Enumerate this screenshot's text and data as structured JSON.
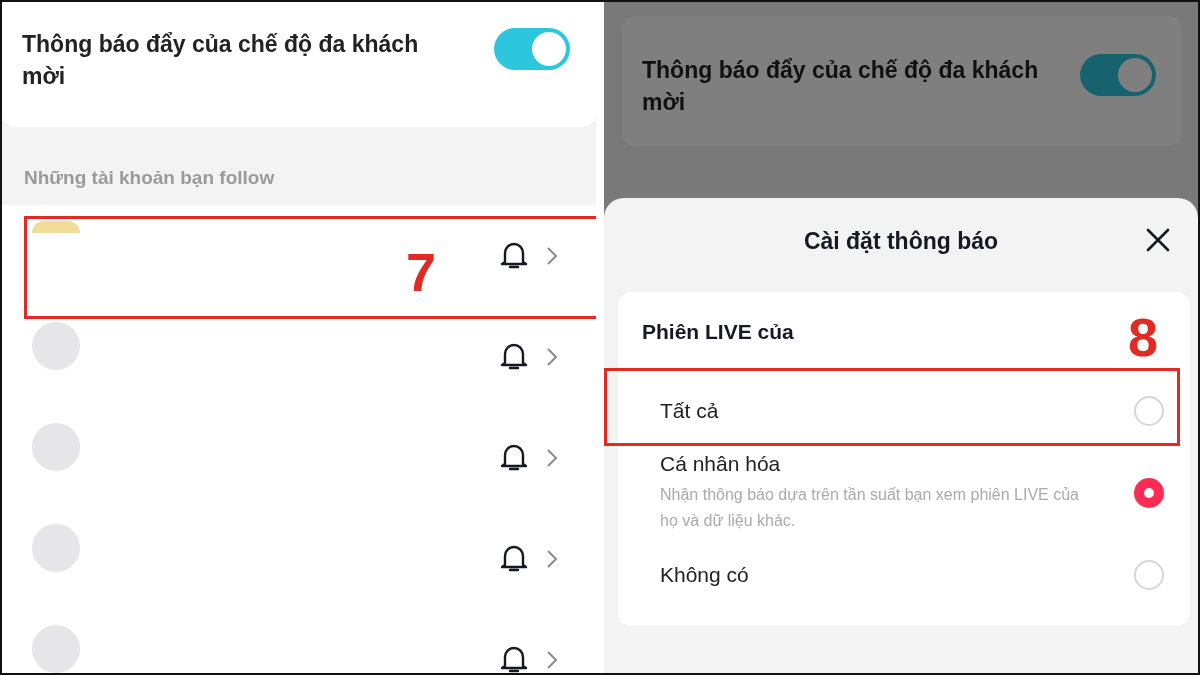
{
  "left": {
    "settings_card": {
      "label": "Thông báo đẩy của chế độ đa khách mời",
      "on": true
    },
    "section_label": "Những tài khoản bạn follow",
    "accounts": [
      {
        "has_avatar": true
      },
      {
        "has_avatar": false
      },
      {
        "has_avatar": false
      },
      {
        "has_avatar": false
      },
      {
        "has_avatar": false
      }
    ],
    "annotation": {
      "label": "7"
    }
  },
  "right": {
    "background": {
      "label": "Thông báo đẩy của chế độ đa khách mời",
      "on": true
    },
    "sheet": {
      "title": "Cài đặt thông báo",
      "section_heading": "Phiên LIVE của",
      "options": [
        {
          "label": "Tất cả",
          "selected": false
        },
        {
          "label": "Cá nhân hóa",
          "description": "Nhận thông báo dựa trên tần suất bạn xem phiên LIVE của họ và dữ liệu khác.",
          "selected": true
        },
        {
          "label": "Không có",
          "selected": false
        }
      ]
    },
    "annotation": {
      "label": "8"
    }
  }
}
